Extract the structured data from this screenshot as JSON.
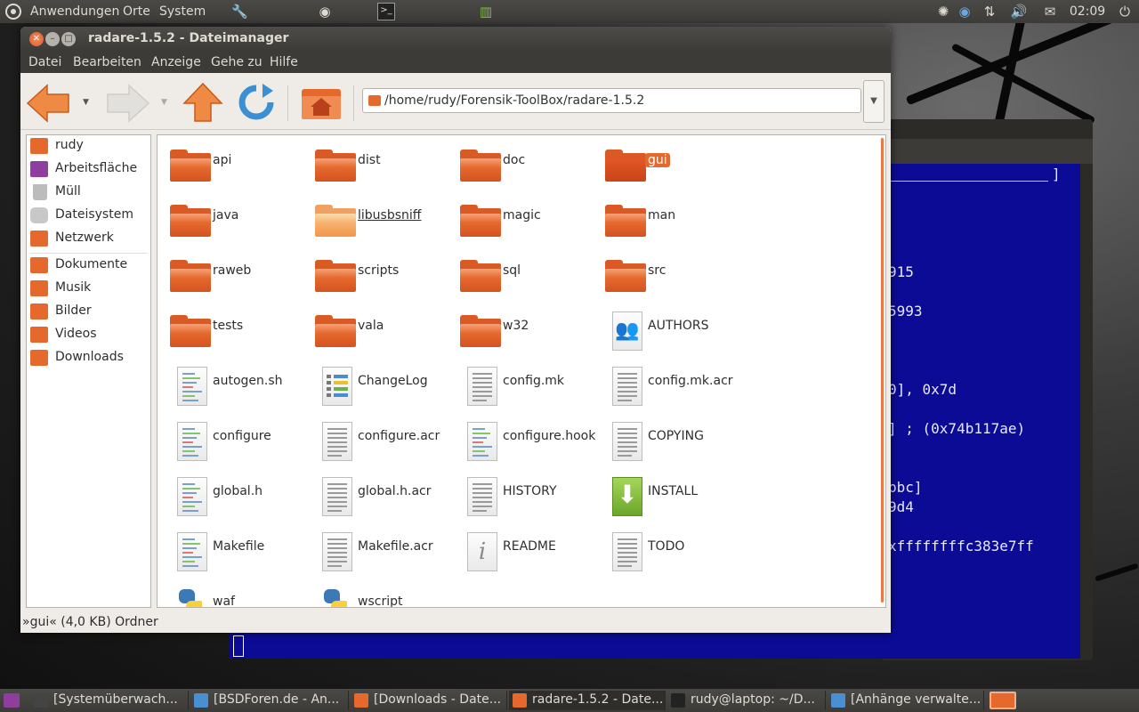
{
  "top_panel": {
    "menus": [
      "Anwendungen",
      "Orte",
      "System"
    ],
    "clock": "02:09"
  },
  "window": {
    "title": "radare-1.5.2 - Dateimanager",
    "menubar": [
      "Datei",
      "Bearbeiten",
      "Anzeige",
      "Gehe zu",
      "Hilfe"
    ],
    "location": "/home/rudy/Forensik-ToolBox/radare-1.5.2",
    "status": "»gui« (4,0 KB) Ordner"
  },
  "sidebar": {
    "places": [
      {
        "label": "rudy",
        "icon": "home-folder-icon",
        "color": "#e5692d"
      },
      {
        "label": "Arbeitsfläche",
        "icon": "desktop-icon",
        "color": "#8e3f9e"
      },
      {
        "label": "Müll",
        "icon": "trash-icon",
        "color": "#bcbcbc"
      },
      {
        "label": "Dateisystem",
        "icon": "harddisk-icon",
        "color": "#c8c8c8"
      },
      {
        "label": "Netzwerk",
        "icon": "network-icon",
        "color": "#e5692d"
      }
    ],
    "bookmarks": [
      {
        "label": "Dokumente",
        "icon": "documents-folder-icon",
        "color": "#e5692d"
      },
      {
        "label": "Musik",
        "icon": "music-folder-icon",
        "color": "#e5692d"
      },
      {
        "label": "Bilder",
        "icon": "pictures-folder-icon",
        "color": "#e5692d"
      },
      {
        "label": "Videos",
        "icon": "videos-folder-icon",
        "color": "#e5692d"
      },
      {
        "label": "Downloads",
        "icon": "downloads-folder-icon",
        "color": "#e5692d"
      }
    ]
  },
  "files": [
    {
      "name": "api",
      "type": "folder"
    },
    {
      "name": "dist",
      "type": "folder"
    },
    {
      "name": "doc",
      "type": "folder"
    },
    {
      "name": "gui",
      "type": "folder-open",
      "selected": true
    },
    {
      "name": "java",
      "type": "folder"
    },
    {
      "name": "libusbsniff",
      "type": "folder-link"
    },
    {
      "name": "magic",
      "type": "folder"
    },
    {
      "name": "man",
      "type": "folder"
    },
    {
      "name": "raweb",
      "type": "folder"
    },
    {
      "name": "scripts",
      "type": "folder"
    },
    {
      "name": "sql",
      "type": "folder"
    },
    {
      "name": "src",
      "type": "folder"
    },
    {
      "name": "tests",
      "type": "folder"
    },
    {
      "name": "vala",
      "type": "folder"
    },
    {
      "name": "w32",
      "type": "folder"
    },
    {
      "name": "AUTHORS",
      "type": "authors"
    },
    {
      "name": "autogen.sh",
      "type": "source"
    },
    {
      "name": "ChangeLog",
      "type": "changelog"
    },
    {
      "name": "config.mk",
      "type": "text"
    },
    {
      "name": "config.mk.acr",
      "type": "text"
    },
    {
      "name": "configure",
      "type": "source"
    },
    {
      "name": "configure.acr",
      "type": "text"
    },
    {
      "name": "configure.hook",
      "type": "source"
    },
    {
      "name": "COPYING",
      "type": "text"
    },
    {
      "name": "global.h",
      "type": "source"
    },
    {
      "name": "global.h.acr",
      "type": "text"
    },
    {
      "name": "HISTORY",
      "type": "text"
    },
    {
      "name": "INSTALL",
      "type": "install"
    },
    {
      "name": "Makefile",
      "type": "source"
    },
    {
      "name": "Makefile.acr",
      "type": "text"
    },
    {
      "name": "README",
      "type": "readme"
    },
    {
      "name": "TODO",
      "type": "text"
    },
    {
      "name": "waf",
      "type": "python"
    },
    {
      "name": "wscript",
      "type": "python"
    }
  ],
  "terminal": {
    "lines": [
      "915",
      "5993",
      "0], 0x7d",
      "] ; (0x74b117ae)",
      "bbc]",
      "9d4",
      "xffffffffc383e7ff"
    ]
  },
  "taskbar": [
    {
      "label": "[Systemüberwach...",
      "icon": "system-monitor-icon"
    },
    {
      "label": "[BSDForen.de - An...",
      "icon": "chromium-icon"
    },
    {
      "label": "[Downloads - Date...",
      "icon": "folder-icon"
    },
    {
      "label": "radare-1.5.2 - Date...",
      "icon": "folder-icon"
    },
    {
      "label": "rudy@laptop: ~/D...",
      "icon": "terminal-icon"
    },
    {
      "label": "[Anhänge verwalte...",
      "icon": "chromium-icon"
    }
  ]
}
